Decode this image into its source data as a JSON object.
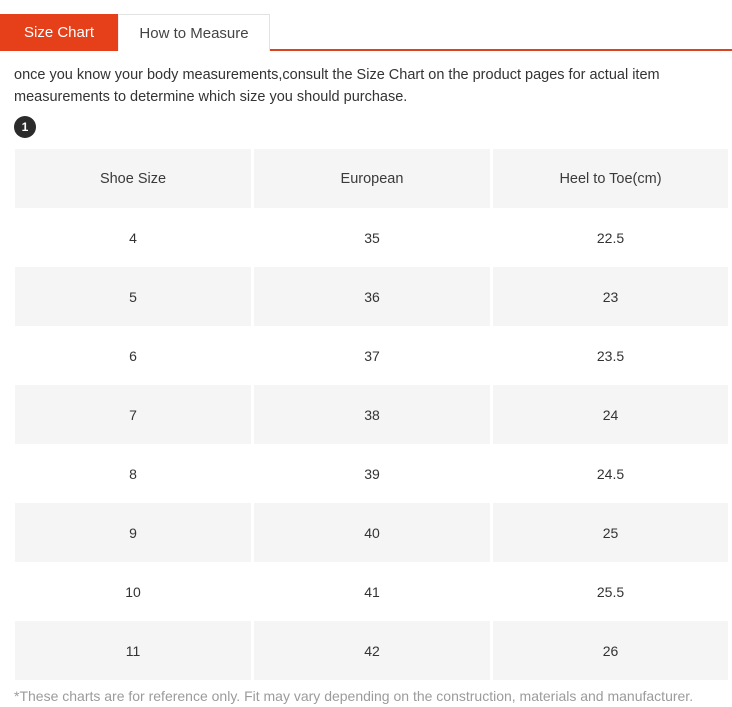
{
  "tabs": [
    {
      "label": "Size Chart",
      "active": true
    },
    {
      "label": "How to Measure",
      "active": false
    }
  ],
  "intro": {
    "text": "once you know your body measurements,consult the Size Chart on the product pages for actual item measurements to determine which size you should purchase."
  },
  "step_badge": {
    "label": "1"
  },
  "chart_data": {
    "type": "table",
    "title": "Size Chart",
    "columns": [
      "Shoe Size",
      "European",
      "Heel to Toe(cm)"
    ],
    "rows": [
      [
        "4",
        "35",
        "22.5"
      ],
      [
        "5",
        "36",
        "23"
      ],
      [
        "6",
        "37",
        "23.5"
      ],
      [
        "7",
        "38",
        "24"
      ],
      [
        "8",
        "39",
        "24.5"
      ],
      [
        "9",
        "40",
        "25"
      ],
      [
        "10",
        "41",
        "25.5"
      ],
      [
        "11",
        "42",
        "26"
      ]
    ]
  },
  "note": {
    "text": "*These charts are for reference only. Fit may vary depending on the construction, materials and manufacturer."
  },
  "colors": {
    "accent": "#e5401a",
    "accent_border": "#d9441f",
    "row_shaded": "#f5f5f5",
    "badge_bg": "#2b2b2b",
    "note_text": "#9b9b9b",
    "body_text": "#333333"
  }
}
